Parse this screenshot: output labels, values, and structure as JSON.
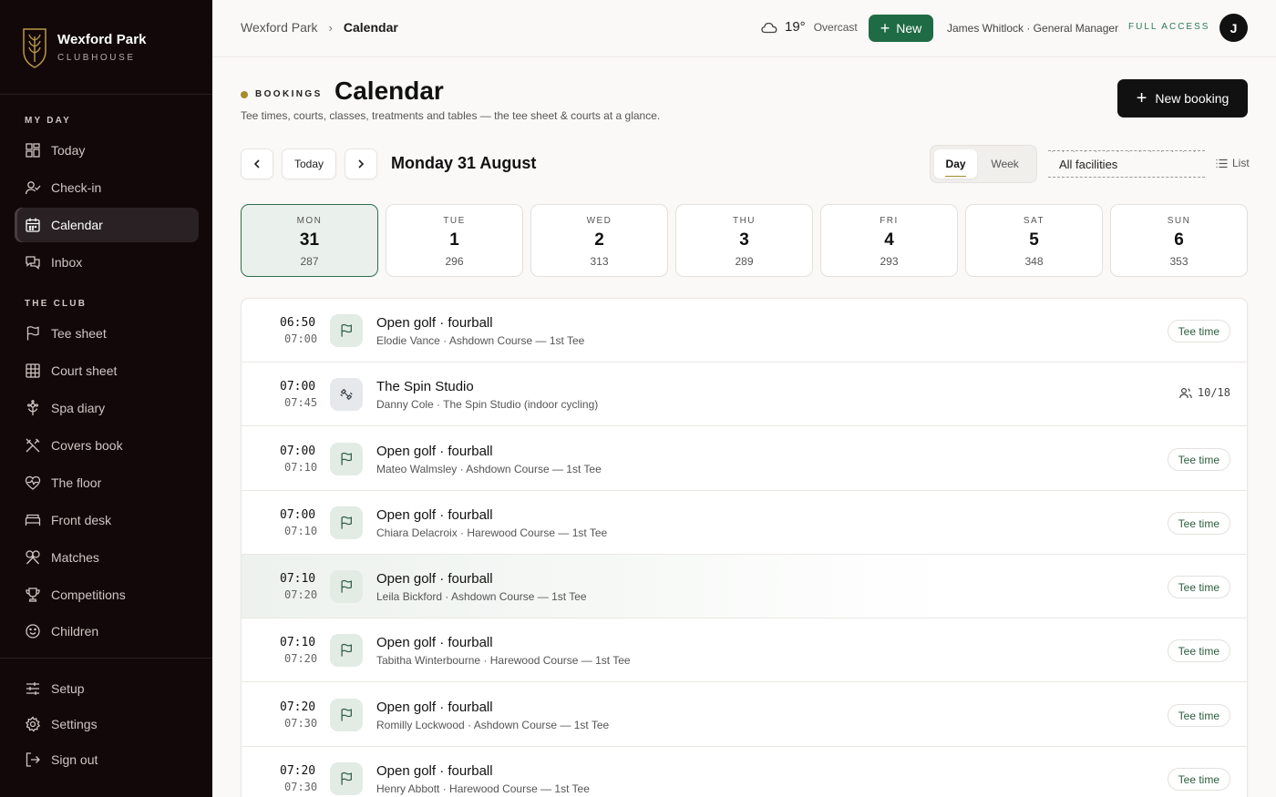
{
  "brand": {
    "name": "Wexford Park",
    "sub": "CLUBHOUSE"
  },
  "sidebar": {
    "sections": [
      {
        "label": "MY DAY"
      },
      {
        "label": "THE CLUB"
      }
    ],
    "items": [
      {
        "label": "Today",
        "icon": "grid-icon"
      },
      {
        "label": "Check-in",
        "icon": "user-check-icon"
      },
      {
        "label": "Calendar",
        "icon": "calendar-icon",
        "active": true
      },
      {
        "label": "Inbox",
        "icon": "chat-icon"
      },
      {
        "label": "Tee sheet",
        "icon": "flag-icon"
      },
      {
        "label": "Court sheet",
        "icon": "court-grid-icon"
      },
      {
        "label": "Spa diary",
        "icon": "flower-icon"
      },
      {
        "label": "Covers book",
        "icon": "cutlery-icon"
      },
      {
        "label": "The floor",
        "icon": "heart-pulse-icon"
      },
      {
        "label": "Front desk",
        "icon": "bed-icon"
      },
      {
        "label": "Matches",
        "icon": "crossed-rackets-icon"
      },
      {
        "label": "Competitions",
        "icon": "trophy-icon"
      },
      {
        "label": "Children",
        "icon": "smiley-icon"
      }
    ],
    "bottom": [
      {
        "label": "Setup",
        "icon": "sliders-icon"
      },
      {
        "label": "Settings",
        "icon": "gear-icon"
      },
      {
        "label": "Sign out",
        "icon": "sign-out-icon"
      }
    ]
  },
  "topbar": {
    "crumb_root": "Wexford Park",
    "crumb_current": "Calendar",
    "temp": "19°",
    "condition": "Overcast",
    "new_label": "New",
    "user": "James Whitlock · General Manager",
    "access": "FULL ACCESS",
    "avatar": "J"
  },
  "header": {
    "eyebrow": "BOOKINGS",
    "title": "Calendar",
    "subtitle": "Tee times, courts, classes, treatments and tables — the tee sheet & courts at a glance.",
    "new_booking": "New booking"
  },
  "datenav": {
    "today": "Today",
    "date_title": "Monday 31 August",
    "view_day": "Day",
    "view_week": "Week",
    "filter": "All facilities",
    "list": "List"
  },
  "days": [
    {
      "dow": "MON",
      "num": "31",
      "count": "287",
      "active": true
    },
    {
      "dow": "TUE",
      "num": "1",
      "count": "296"
    },
    {
      "dow": "WED",
      "num": "2",
      "count": "313"
    },
    {
      "dow": "THU",
      "num": "3",
      "count": "289"
    },
    {
      "dow": "FRI",
      "num": "4",
      "count": "293"
    },
    {
      "dow": "SAT",
      "num": "5",
      "count": "348"
    },
    {
      "dow": "SUN",
      "num": "6",
      "count": "353"
    }
  ],
  "bookings": [
    {
      "start": "06:50",
      "end": "07:00",
      "title": "Open golf · fourball",
      "sub": "Elodie Vance · Ashdown Course — 1st Tee",
      "tag": "Tee time",
      "icon": "flag-icon"
    },
    {
      "start": "07:00",
      "end": "07:45",
      "title": "The Spin Studio",
      "sub": "Danny Cole · The Spin Studio (indoor cycling)",
      "capacity": "10/18",
      "icon": "dumbbell-icon"
    },
    {
      "start": "07:00",
      "end": "07:10",
      "title": "Open golf · fourball",
      "sub": "Mateo Walmsley · Ashdown Course — 1st Tee",
      "tag": "Tee time",
      "icon": "flag-icon"
    },
    {
      "start": "07:00",
      "end": "07:10",
      "title": "Open golf · fourball",
      "sub": "Chiara Delacroix · Harewood Course — 1st Tee",
      "tag": "Tee time",
      "icon": "flag-icon"
    },
    {
      "start": "07:10",
      "end": "07:20",
      "title": "Open golf · fourball",
      "sub": "Leila Bickford · Ashdown Course — 1st Tee",
      "tag": "Tee time",
      "icon": "flag-icon",
      "highlight": true
    },
    {
      "start": "07:10",
      "end": "07:20",
      "title": "Open golf · fourball",
      "sub": "Tabitha Winterbourne · Harewood Course — 1st Tee",
      "tag": "Tee time",
      "icon": "flag-icon"
    },
    {
      "start": "07:20",
      "end": "07:30",
      "title": "Open golf · fourball",
      "sub": "Romilly Lockwood · Ashdown Course — 1st Tee",
      "tag": "Tee time",
      "icon": "flag-icon"
    },
    {
      "start": "07:20",
      "end": "07:30",
      "title": "Open golf · fourball",
      "sub": "Henry Abbott · Harewood Course — 1st Tee",
      "tag": "Tee time",
      "icon": "flag-icon"
    }
  ],
  "colors": {
    "accent": "#1f6b45",
    "gold": "#a68a2d",
    "sidebar": "#120709"
  }
}
